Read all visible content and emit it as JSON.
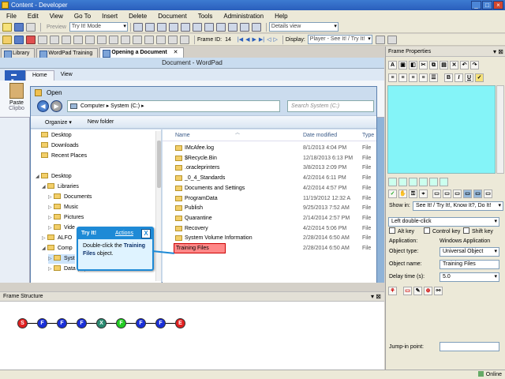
{
  "window": {
    "title": "Content - Developer"
  },
  "menu": [
    "File",
    "Edit",
    "View",
    "Go To",
    "Insert",
    "Delete",
    "Document",
    "Tools",
    "Administration",
    "Help"
  ],
  "toolbar1": {
    "preview_label": "Preview",
    "mode_value": "Try It! Mode",
    "view_value": "Details view"
  },
  "toolbar2": {
    "frame_id_label": "Frame ID:",
    "frame_id_value": "14",
    "display_label": "Display:",
    "display_value": "Player - See It! / Try It!"
  },
  "doc_tabs": [
    {
      "label": "Library"
    },
    {
      "label": "WordPad Training"
    },
    {
      "label": "Opening a Document"
    }
  ],
  "wordpad": {
    "title": "Document - WordPad",
    "tabs": [
      "Home",
      "View"
    ],
    "paste_label": "Paste",
    "clipboard_label": "Clipbo"
  },
  "open_dialog": {
    "title": "Open",
    "address_parts": [
      "Computer",
      "System (C:)"
    ],
    "search_placeholder": "Search System (C:)",
    "commands": [
      "Organize ▾",
      "New folder"
    ],
    "nav_items": [
      {
        "label": "Desktop",
        "indent": 0,
        "exp": ""
      },
      {
        "label": "Downloads",
        "indent": 0,
        "exp": ""
      },
      {
        "label": "Recent Places",
        "indent": 0,
        "exp": ""
      },
      {
        "label": "Desktop",
        "indent": 0,
        "exp": "◢"
      },
      {
        "label": "Libraries",
        "indent": 1,
        "exp": "◢"
      },
      {
        "label": "Documents",
        "indent": 2,
        "exp": "▷"
      },
      {
        "label": "Music",
        "indent": 2,
        "exp": "▷"
      },
      {
        "label": "Pictures",
        "indent": 2,
        "exp": "▷"
      },
      {
        "label": "Vide",
        "indent": 2,
        "exp": "▷"
      },
      {
        "label": "ALFO",
        "indent": 1,
        "exp": "▷"
      },
      {
        "label": "Comp",
        "indent": 1,
        "exp": "◢"
      },
      {
        "label": "Syst",
        "indent": 2,
        "exp": "▷"
      },
      {
        "label": "Data (D:)",
        "indent": 2,
        "exp": "▷"
      }
    ],
    "columns": {
      "name": "Name",
      "date": "Date modified",
      "type": "Type"
    },
    "files": [
      {
        "name": "IMcAfee.log",
        "date": "8/1/2013 4:04 PM",
        "type": "File"
      },
      {
        "name": "$Recycle.Bin",
        "date": "12/18/2013 6:13 PM",
        "type": "File"
      },
      {
        "name": ".oracleprinters",
        "date": "3/8/2013 2:09 PM",
        "type": "File"
      },
      {
        "name": "_0_4_Standards",
        "date": "4/2/2014 6:11 PM",
        "type": "File"
      },
      {
        "name": "Documents and Settings",
        "date": "4/2/2014 4:57 PM",
        "type": "File"
      },
      {
        "name": "ProgramData",
        "date": "11/19/2012 12:32 A",
        "type": "File"
      },
      {
        "name": "Publish",
        "date": "9/25/2013 7:52 AM",
        "type": "File"
      },
      {
        "name": "Quarantine",
        "date": "2/14/2014 2:57 PM",
        "type": "File"
      },
      {
        "name": "Recovery",
        "date": "4/2/2014 5:06 PM",
        "type": "File"
      },
      {
        "name": "System Volume Information",
        "date": "2/28/2014 6:50 AM",
        "type": "File"
      },
      {
        "name": "Training Files",
        "date": "2/28/2014 6:50 AM",
        "type": "File"
      }
    ]
  },
  "tryit": {
    "title": "Try It!",
    "actions": "Actions",
    "close": "X",
    "instruction_prefix": "Double-click the",
    "instruction_bold": "Training Files",
    "instruction_suffix": "object."
  },
  "frame_properties": {
    "title": "Frame Properties",
    "show_in_label": "Show in:",
    "show_in_value": "See It! / Try It!, Know It?, Do It!",
    "action_value": "Left double-click",
    "alt_key": "Alt key",
    "ctrl_key": "Control key",
    "shift_key": "Shift key",
    "application_label": "Application:",
    "application_value": "Windows Application",
    "object_type_label": "Object type:",
    "object_type_value": "Universal Object",
    "object_name_label": "Object name:",
    "object_name_value": "Training Files",
    "delay_label": "Delay time (s):",
    "delay_value": "5.0",
    "jump_in_label": "Jump-in point:"
  },
  "frame_structure": {
    "title": "Frame Structure",
    "nodes": [
      {
        "label": "S",
        "color": "#e02020"
      },
      {
        "label": "F",
        "color": "#1a2fd8"
      },
      {
        "label": "F",
        "color": "#1a2fd8"
      },
      {
        "label": "F",
        "color": "#1a2fd8"
      },
      {
        "label": "X",
        "color": "#2a8a70"
      },
      {
        "label": "F",
        "color": "#22cc22"
      },
      {
        "label": "F",
        "color": "#1a2fd8"
      },
      {
        "label": "F",
        "color": "#1a2fd8"
      },
      {
        "label": "E",
        "color": "#e02020"
      }
    ]
  },
  "status": {
    "online": "Online"
  }
}
